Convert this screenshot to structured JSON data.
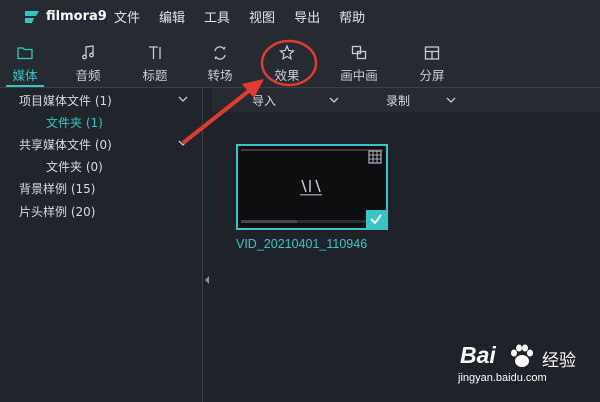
{
  "app": {
    "logo_text": "filmora9"
  },
  "menu": [
    "文件",
    "编辑",
    "工具",
    "视图",
    "导出",
    "帮助"
  ],
  "toolbar": {
    "items": [
      {
        "label": "媒体",
        "icon": "folder-icon",
        "active": true
      },
      {
        "label": "音频",
        "icon": "music-note-icon",
        "active": false
      },
      {
        "label": "标题",
        "icon": "title-text-icon",
        "active": false
      },
      {
        "label": "转场",
        "icon": "transition-icon",
        "active": false
      },
      {
        "label": "效果",
        "icon": "effects-star-icon",
        "active": false
      },
      {
        "label": "画中画",
        "icon": "pip-icon",
        "active": false
      },
      {
        "label": "分屏",
        "icon": "split-screen-icon",
        "active": false
      }
    ]
  },
  "sidebar": {
    "items": [
      {
        "label": "项目媒体文件 (1)",
        "expanded": true
      },
      {
        "label": "文件夹 (1)",
        "active": true
      },
      {
        "label": "共享媒体文件 (0)",
        "expanded": true
      },
      {
        "label": "文件夹 (0)"
      },
      {
        "label": "背景样例 (15)"
      },
      {
        "label": "片头样例 (20)"
      }
    ]
  },
  "content": {
    "import_label": "导入",
    "record_label": "录制",
    "clip": {
      "name": "VID_20210401_110946",
      "selected": true
    }
  },
  "watermark": {
    "brand": "Bai",
    "brand_cn": "经验",
    "url": "jingyan.baidu.com"
  },
  "colors": {
    "accent": "#37c5c3",
    "annotation": "#e23b2e",
    "background": "#1f2329"
  }
}
